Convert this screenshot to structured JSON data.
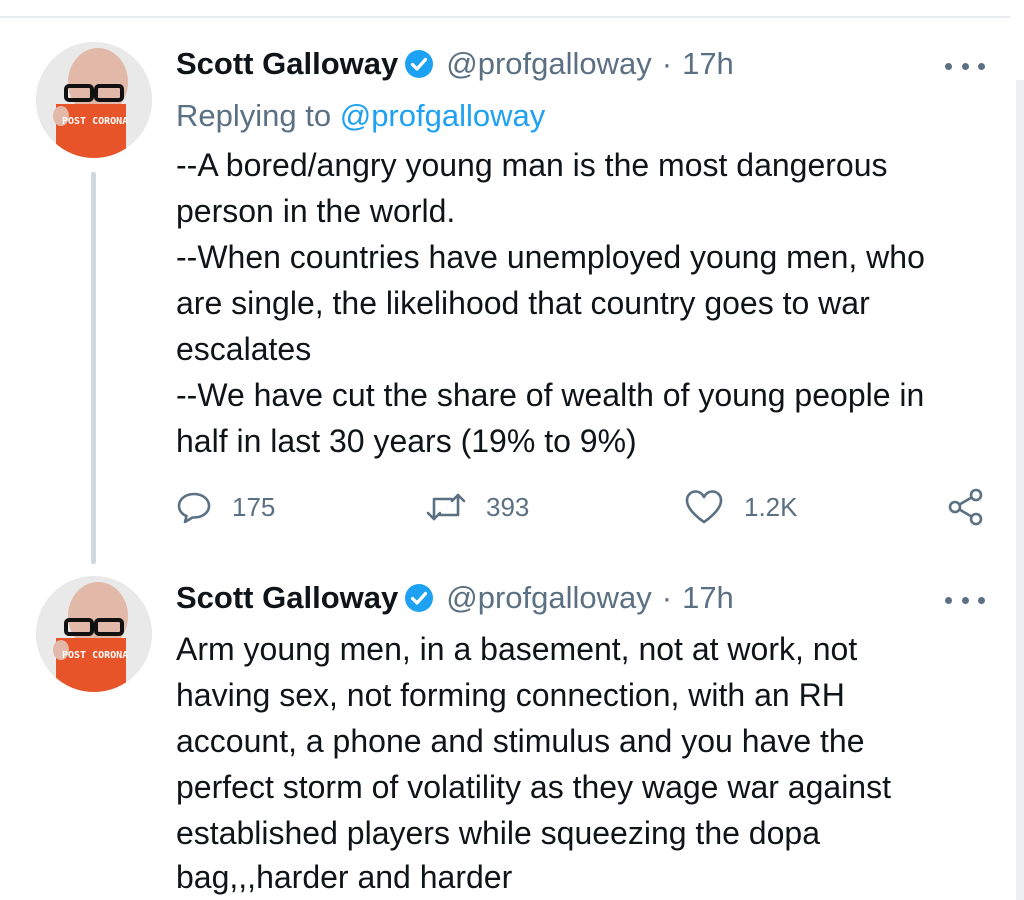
{
  "tweets": [
    {
      "author_name": "Scott Galloway",
      "handle": "@profgalloway",
      "separator": "·",
      "time": "17h",
      "reply_prefix": "Replying to",
      "reply_to": "@profgalloway",
      "lines": [
        "--A bored/angry young man is the most dangerous",
        "person in the world.",
        "--When countries have unemployed young men, who",
        "are single, the likelihood that country goes to war",
        "escalates",
        "--We have cut the share of wealth of young people in",
        "half in last 30 years (19% to 9%)"
      ],
      "reply_count": "175",
      "retweet_count": "393",
      "like_count": "1.2K",
      "avatar_book_text": "POST CORONA"
    },
    {
      "author_name": "Scott Galloway",
      "handle": "@profgalloway",
      "separator": "·",
      "time": "17h",
      "lines": [
        "Arm young men, in a basement, not at work, not",
        "having sex, not forming connection, with an RH",
        "account, a phone and stimulus and you have the",
        "perfect storm of volatility as they wage war against",
        "established players while squeezing the dopa",
        "bag,,,harder and harder"
      ],
      "avatar_book_text": "POST CORONA"
    }
  ],
  "colors": {
    "verified_blue": "#1da1f2",
    "secondary_text": "#5b7083",
    "mention_blue": "#1da1f2",
    "book_orange": "#e8542a"
  },
  "icons": {
    "verified": "verified-badge-icon",
    "more": "more-horizontal-icon",
    "reply": "reply-icon",
    "retweet": "retweet-icon",
    "like": "heart-icon",
    "share": "share-icon"
  }
}
